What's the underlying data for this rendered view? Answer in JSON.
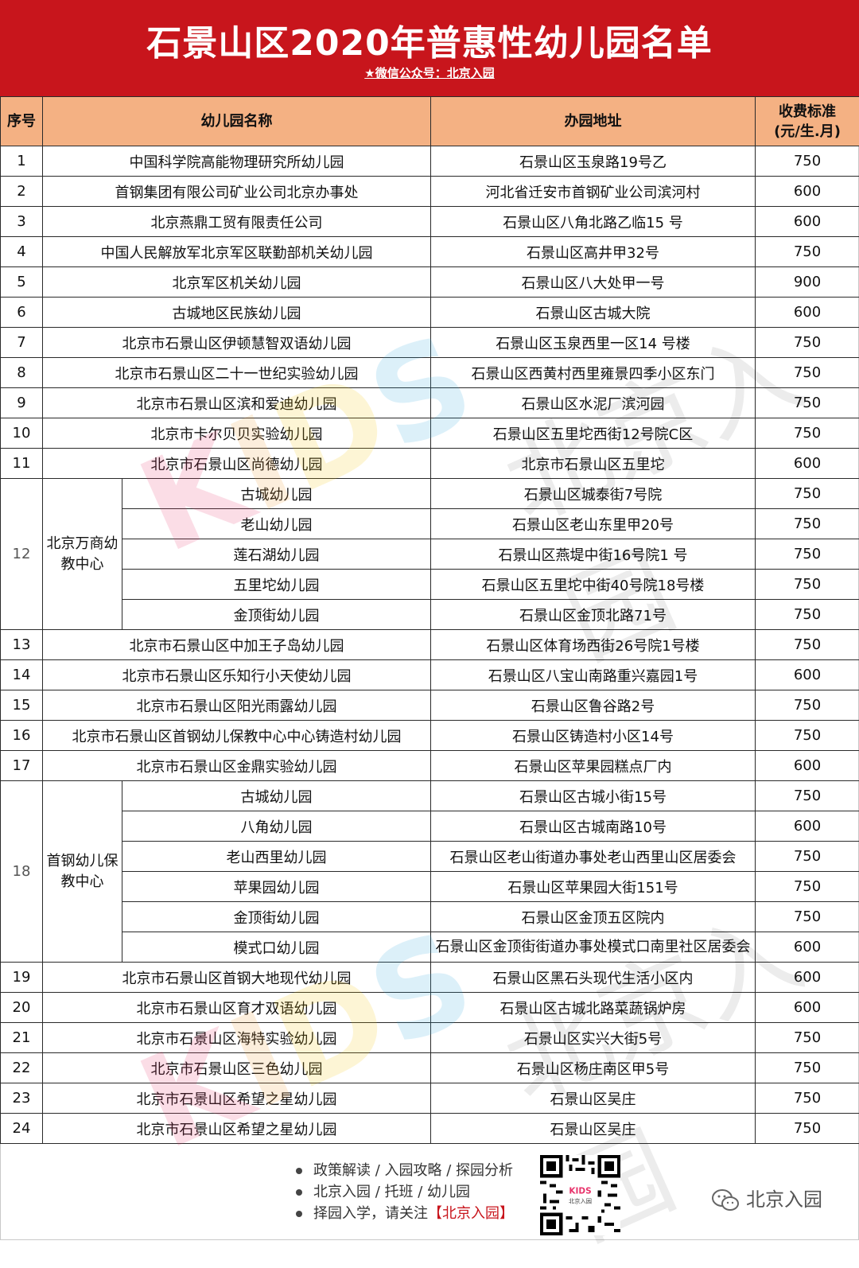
{
  "header": {
    "title": "石景山区2020年普惠性幼儿园名单",
    "subtitle": "★微信公众号：北京入园"
  },
  "columns": {
    "seq": "序号",
    "name": "幼儿园名称",
    "address": "办园地址",
    "fee": "收费标准\n(元/生.月)"
  },
  "rows_a": [
    {
      "seq": "1",
      "name": "中国科学院高能物理研究所幼儿园",
      "address": "石景山区玉泉路19号乙",
      "fee": "750"
    },
    {
      "seq": "2",
      "name": "首钢集团有限公司矿业公司北京办事处",
      "address": "河北省迁安市首钢矿业公司滨河村",
      "fee": "600"
    },
    {
      "seq": "3",
      "name": "北京燕鼎工贸有限责任公司",
      "address": "石景山区八角北路乙临15 号",
      "fee": "600"
    },
    {
      "seq": "4",
      "name": "中国人民解放军北京军区联勤部机关幼儿园",
      "address": "石景山区高井甲32号",
      "fee": "750"
    },
    {
      "seq": "5",
      "name": "北京军区机关幼儿园",
      "address": "石景山区八大处甲一号",
      "fee": "900"
    },
    {
      "seq": "6",
      "name": "古城地区民族幼儿园",
      "address": "石景山区古城大院",
      "fee": "600"
    },
    {
      "seq": "7",
      "name": "北京市石景山区伊顿慧智双语幼儿园",
      "address": "石景山区玉泉西里一区14 号楼",
      "fee": "750"
    },
    {
      "seq": "8",
      "name": "北京市石景山区二十一世纪实验幼儿园",
      "address": "石景山区西黄村西里雍景四季小区东门",
      "fee": "750"
    },
    {
      "seq": "9",
      "name": "北京市石景山区滨和爱迪幼儿园",
      "address": "石景山区水泥厂滨河园",
      "fee": "750"
    },
    {
      "seq": "10",
      "name": "北京市卡尔贝贝实验幼儿园",
      "address": "石景山区五里坨西街12号院C区",
      "fee": "750"
    },
    {
      "seq": "11",
      "name": "北京市石景山区尚德幼儿园",
      "address": "北京市石景山区五里坨",
      "fee": "600"
    }
  ],
  "group12": {
    "seq": "12",
    "label": "北京万商幼教中心",
    "items": [
      {
        "name": "古城幼儿园",
        "address": "石景山区城泰街7号院",
        "fee": "750"
      },
      {
        "name": "老山幼儿园",
        "address": "石景山区老山东里甲20号",
        "fee": "750"
      },
      {
        "name": "莲石湖幼儿园",
        "address": "石景山区燕堤中街16号院1 号",
        "fee": "750"
      },
      {
        "name": "五里坨幼儿园",
        "address": "石景山区五里坨中街40号院18号楼",
        "fee": "750"
      },
      {
        "name": "金顶街幼儿园",
        "address": "石景山区金顶北路71号",
        "fee": "750"
      }
    ]
  },
  "rows_b": [
    {
      "seq": "13",
      "name": "北京市石景山区中加王子岛幼儿园",
      "address": "石景山区体育场西街26号院1号楼",
      "fee": "750"
    },
    {
      "seq": "14",
      "name": "北京市石景山区乐知行小天使幼儿园",
      "address": "石景山区八宝山南路重兴嘉园1号",
      "fee": "600"
    },
    {
      "seq": "15",
      "name": "北京市石景山区阳光雨露幼儿园",
      "address": "石景山区鲁谷路2号",
      "fee": "750"
    },
    {
      "seq": "16",
      "name": "北京市石景山区首钢幼儿保教中心中心铸造村幼儿园",
      "address": "石景山区铸造村小区14号",
      "fee": "750"
    },
    {
      "seq": "17",
      "name": "北京市石景山区金鼎实验幼儿园",
      "address": "石景山区苹果园糕点厂内",
      "fee": "600"
    }
  ],
  "group18": {
    "seq": "18",
    "label": "首钢幼儿保教中心",
    "items": [
      {
        "name": "古城幼儿园",
        "address": "石景山区古城小街15号",
        "fee": "750"
      },
      {
        "name": "八角幼儿园",
        "address": "石景山区古城南路10号",
        "fee": "600"
      },
      {
        "name": "老山西里幼儿园",
        "address": "石景山区老山街道办事处老山西里山区居委会",
        "fee": "750"
      },
      {
        "name": "苹果园幼儿园",
        "address": "石景山区苹果园大街151号",
        "fee": "750"
      },
      {
        "name": "金顶街幼儿园",
        "address": "石景山区金顶五区院内",
        "fee": "750"
      },
      {
        "name": "模式口幼儿园",
        "address": "石景山区金顶街街道办事处模式口南里社区居委会",
        "fee": "600"
      }
    ]
  },
  "rows_c": [
    {
      "seq": "19",
      "name": "北京市石景山区首钢大地现代幼儿园",
      "address": "石景山区黑石头现代生活小区内",
      "fee": "600"
    },
    {
      "seq": "20",
      "name": "北京市石景山区育才双语幼儿园",
      "address": "石景山区古城北路菜蔬锅炉房",
      "fee": "600"
    },
    {
      "seq": "21",
      "name": "北京市石景山区海特实验幼儿园",
      "address": "石景山区实兴大街5号",
      "fee": "750"
    },
    {
      "seq": "22",
      "name": "北京市石景山区三色幼儿园",
      "address": "石景山区杨庄南区甲5号",
      "fee": "750"
    },
    {
      "seq": "23",
      "name": "北京市石景山区希望之星幼儿园",
      "address": "石景山区吴庄",
      "fee": "750"
    },
    {
      "seq": "24",
      "name": "北京市石景山区希望之星幼儿园",
      "address": "石景山区吴庄",
      "fee": "750"
    }
  ],
  "footer": {
    "lines": [
      "政策解读 / 入园攻略 / 探园分析",
      "北京入园 / 托班 / 幼儿园",
      "择园入学，请关注"
    ],
    "highlight": "【北京入园】",
    "brand": "北京入园"
  },
  "watermark": {
    "latin": "KIDS",
    "cn": "北京入园"
  },
  "colors": {
    "header_red": "#c8151c",
    "header_row": "#f4b183"
  }
}
